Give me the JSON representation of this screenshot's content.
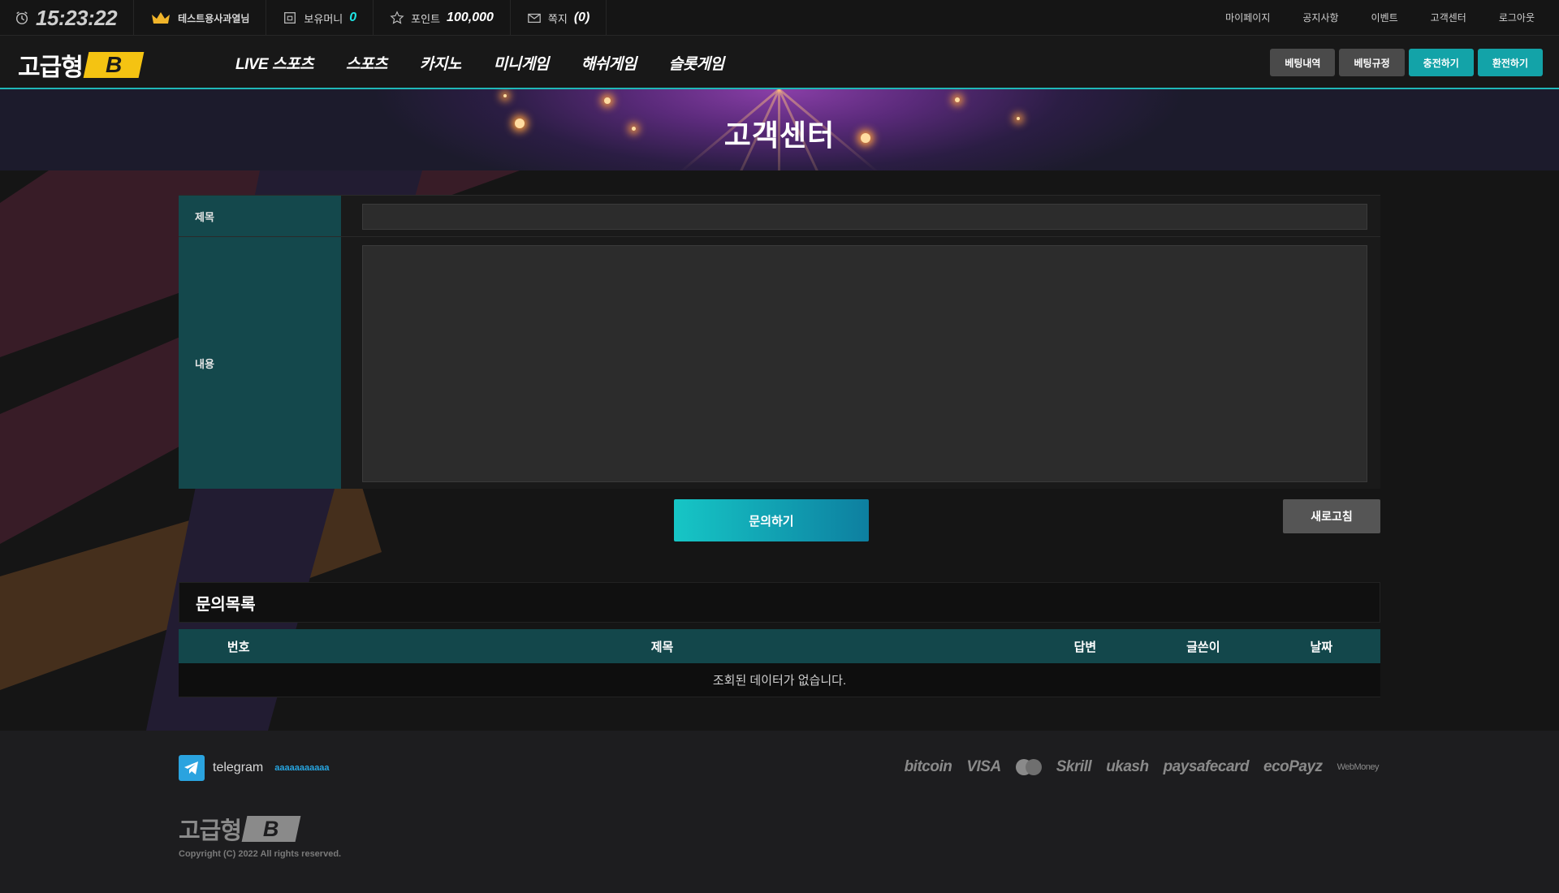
{
  "topbar": {
    "clock": "15:23:22",
    "user": "테스트용사과열님",
    "money_label": "보유머니",
    "money_value": "0",
    "point_label": "포인트",
    "point_value": "100,000",
    "message_label": "쪽지",
    "message_value": "(0)",
    "links": [
      "마이페이지",
      "공지사항",
      "이벤트",
      "고객센터",
      "로그아웃"
    ],
    "icons": [
      "clock-icon",
      "crown-icon",
      "wallet-icon",
      "star-icon",
      "mail-icon"
    ]
  },
  "nav": {
    "logo_text": "고급형",
    "logo_badge": "B",
    "menu": [
      "LIVE 스포츠",
      "스포츠",
      "카지노",
      "미니게임",
      "해쉬게임",
      "슬롯게임"
    ],
    "buttons": [
      "베팅내역",
      "베팅규정",
      "충전하기",
      "환전하기"
    ]
  },
  "hero": {
    "title": "고객센터"
  },
  "form": {
    "title_label": "제목",
    "title_value": "",
    "content_label": "내용",
    "content_value": "",
    "submit_label": "문의하기",
    "refresh_label": "새로고침"
  },
  "list": {
    "title": "문의목록",
    "columns": [
      "번호",
      "제목",
      "답변",
      "글쓴이",
      "날짜"
    ],
    "empty_text": "조회된 데이터가 없습니다."
  },
  "footer": {
    "telegram_label": "telegram",
    "telegram_id": "aaaaaaaaaaa",
    "payments": [
      "bitcoin",
      "VISA",
      "mastercard",
      "Skrill",
      "ukash",
      "paysafecard",
      "ecoPayz",
      "WebMoney"
    ],
    "logo_text": "고급형",
    "logo_badge": "B",
    "copyright": "Copyright (C) 2022 All rights reserved."
  },
  "colors": {
    "accent": "#13a3a8",
    "logo_yellow": "#f4c312",
    "label_bg": "#14484c",
    "cyan_text": "#1ee3e3"
  }
}
